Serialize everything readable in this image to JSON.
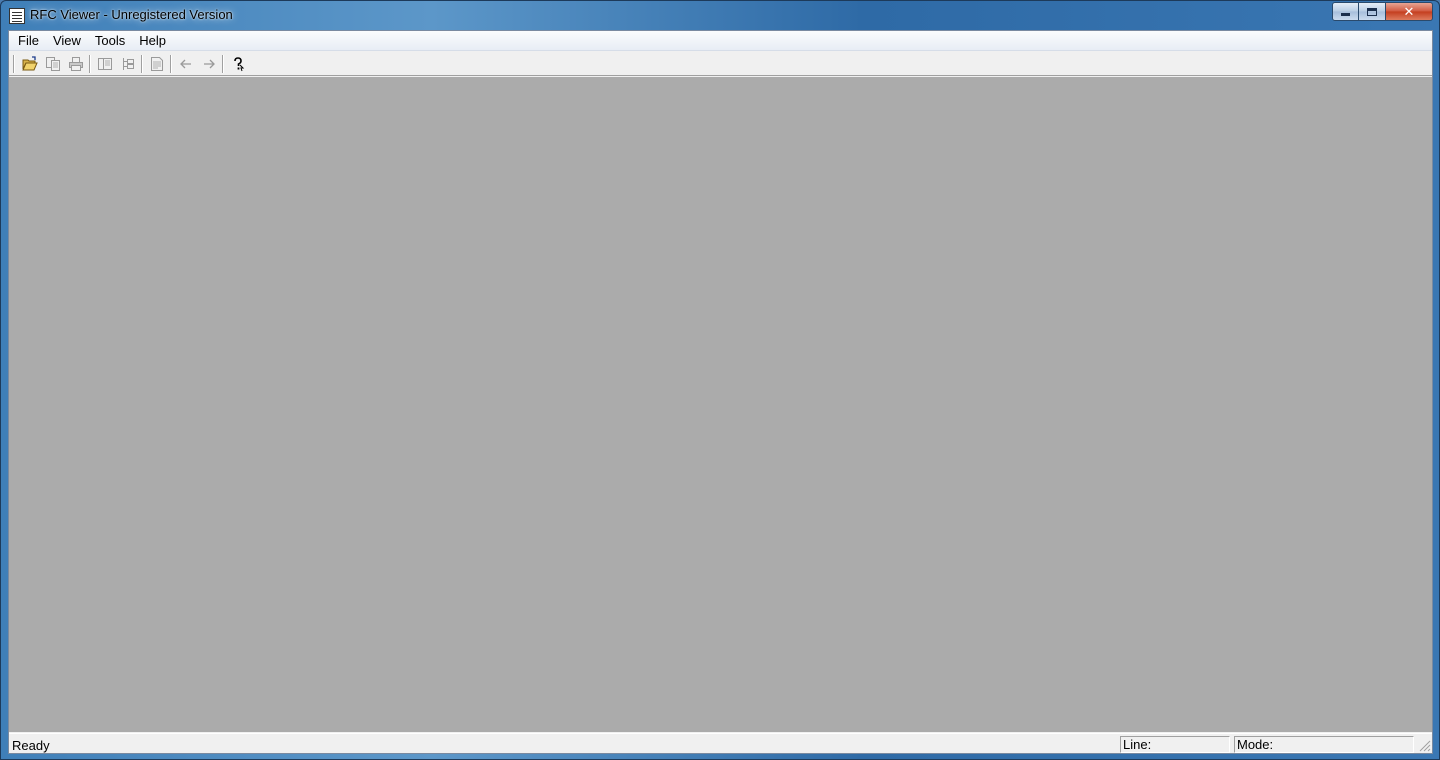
{
  "window": {
    "title": "RFC Viewer - Unregistered Version",
    "app_icon": "document-icon"
  },
  "caption_buttons": {
    "minimize_icon": "minimize-icon",
    "maximize_icon": "maximize-icon",
    "close_glyph": "✕",
    "close_icon": "close-icon"
  },
  "menubar": {
    "items": [
      "File",
      "View",
      "Tools",
      "Help"
    ]
  },
  "toolbar": {
    "buttons": [
      {
        "icon": "open-folder-icon",
        "enabled": true
      },
      {
        "icon": "copy-icon",
        "enabled": false
      },
      {
        "icon": "print-icon",
        "enabled": false
      },
      {
        "icon": "contents-icon",
        "enabled": false
      },
      {
        "icon": "tree-icon",
        "enabled": false
      },
      {
        "icon": "document-view-icon",
        "enabled": false
      },
      {
        "icon": "back-arrow-icon",
        "enabled": false
      },
      {
        "icon": "forward-arrow-icon",
        "enabled": false
      },
      {
        "icon": "help-icon",
        "enabled": true
      }
    ]
  },
  "workspace": {
    "background": "#ababab"
  },
  "statusbar": {
    "status": "Ready",
    "line_label": "Line:",
    "mode_label": "Mode:"
  }
}
